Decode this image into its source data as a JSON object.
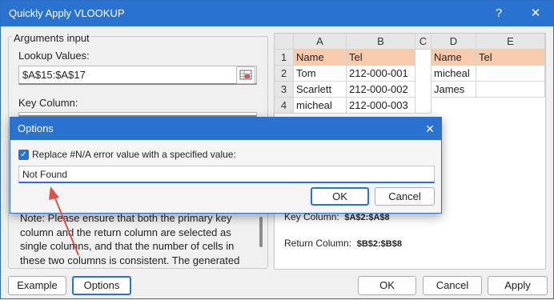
{
  "window": {
    "title": "Quickly Apply VLOOKUP",
    "help_icon": "?",
    "close_icon": "✕"
  },
  "arguments": {
    "group_title": "Arguments input",
    "lookup_label": "Lookup Values:",
    "lookup_value": "$A$15:$A$17",
    "key_label": "Key Column:",
    "note": "Note: Please ensure that both the primary key column and the return column are selected as single columns, and that the number of cells in these two columns is consistent. The generated results will be stored in the same location as the lookup values."
  },
  "sheet": {
    "col_headers": [
      "A",
      "B",
      "C",
      "D",
      "E"
    ],
    "row_headers": [
      "1",
      "2",
      "3",
      "4"
    ],
    "cells": {
      "a1": "Name",
      "b1": "Tel",
      "d1": "Name",
      "e1": "Tel",
      "a2": "Tom",
      "b2": "212-000-001",
      "d2": "micheal",
      "a3": "Scarlett",
      "b3": "212-000-002",
      "d3": "James",
      "a4": "micheal",
      "b4": "212-000-003"
    },
    "key_label": "Key Column:",
    "key_value": "$A$2:$A$8",
    "return_label": "Return Column:",
    "return_value": "$B$2:$B$8",
    "header_color": "#f8cbad"
  },
  "buttons": {
    "example": "Example",
    "options": "Options",
    "ok": "OK",
    "cancel": "Cancel",
    "apply": "Apply"
  },
  "options_dialog": {
    "title": "Options",
    "close_icon": "✕",
    "checkbox_mark": "✓",
    "checkbox_label": "Replace #N/A error value with a specified value:",
    "input_value": "Not Found",
    "ok": "OK",
    "cancel": "Cancel"
  },
  "colors": {
    "accent": "#2a72d0",
    "annotation_arrow": "#d9534f"
  }
}
